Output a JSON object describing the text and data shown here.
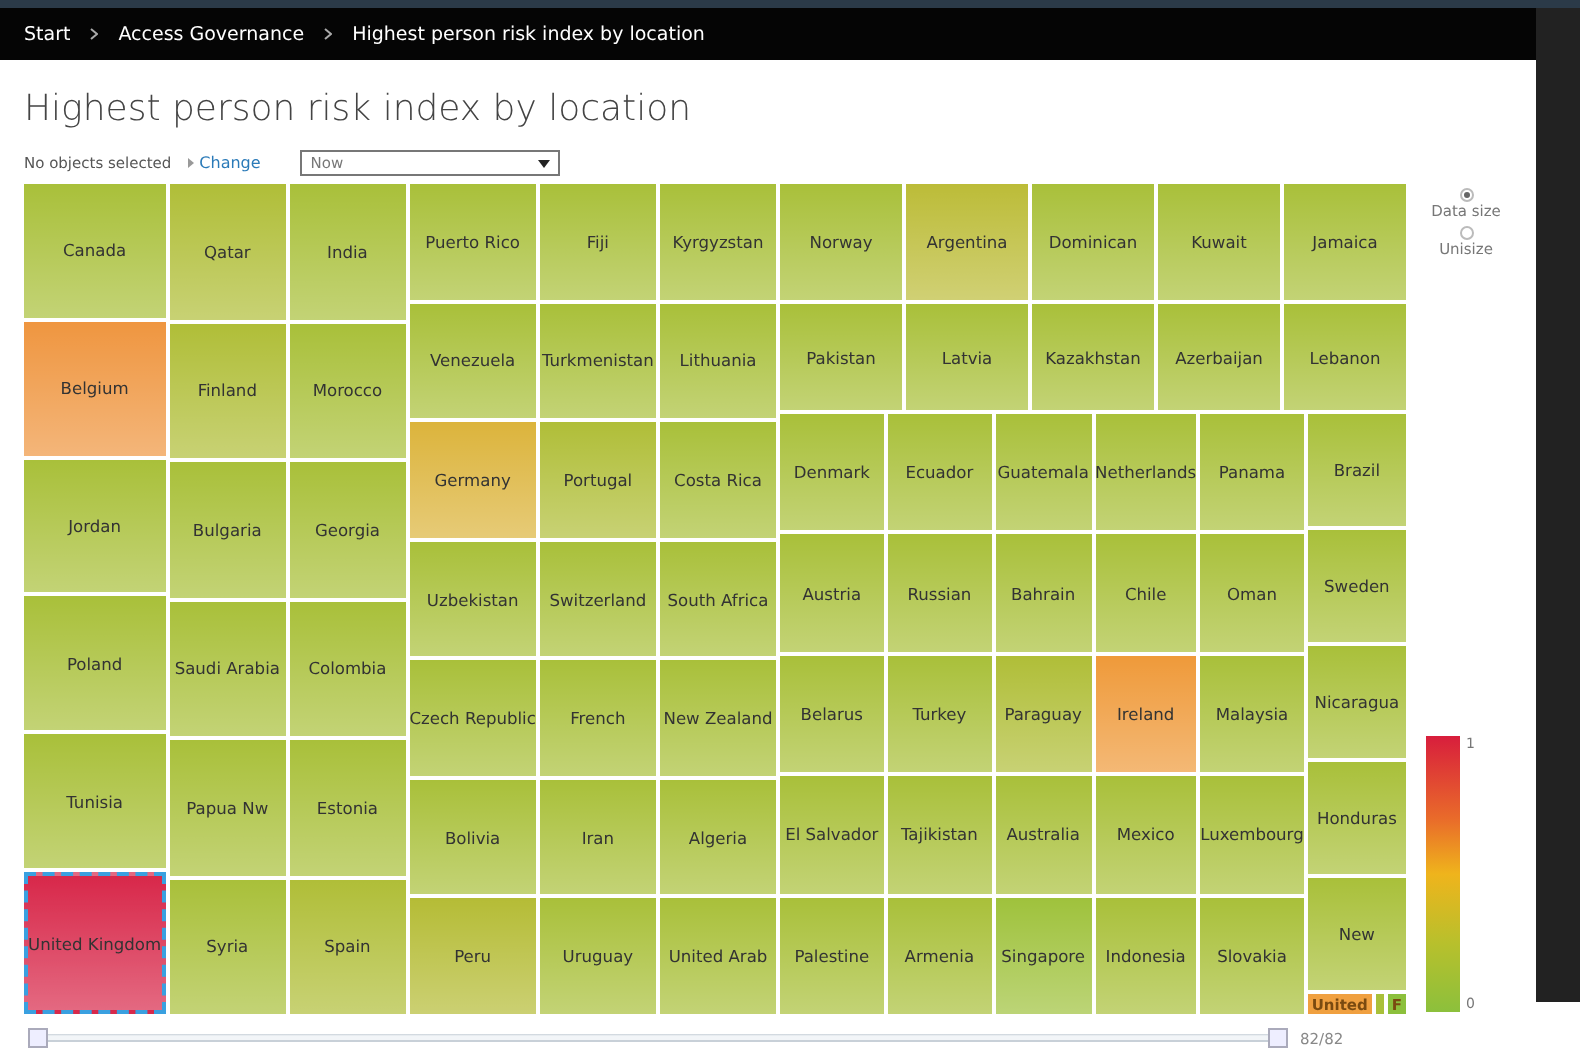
{
  "breadcrumb": [
    {
      "label": "Start"
    },
    {
      "label": "Access Governance"
    },
    {
      "label": "Highest person risk index by location"
    }
  ],
  "title": "Highest person risk index by location",
  "toolbar": {
    "selection": "No objects selected",
    "change_link": "Change",
    "time_dropdown": "Now"
  },
  "treemap": {
    "left_columns": [
      {
        "tiles": [
          {
            "label": "Canada",
            "color": "#a9c03a",
            "selected": false
          },
          {
            "label": "Belgium",
            "color": "#ef9640",
            "selected": false
          },
          {
            "label": "Jordan",
            "color": "#a9c03a",
            "selected": false
          },
          {
            "label": "Poland",
            "color": "#a9c03a",
            "selected": false
          },
          {
            "label": "Tunisia",
            "color": "#a9c03a",
            "selected": false
          },
          {
            "label": "United Kingdom",
            "color": "#d8284a",
            "selected": true
          }
        ]
      },
      {
        "tiles": [
          {
            "label": "Qatar",
            "color": "#b0be38",
            "selected": false
          },
          {
            "label": "Finland",
            "color": "#b0be38",
            "selected": false
          },
          {
            "label": "Bulgaria",
            "color": "#a9c03a",
            "selected": false
          },
          {
            "label": "Saudi Arabia",
            "color": "#a9c03a",
            "selected": false
          },
          {
            "label": "Papua Nw",
            "color": "#a9c03a",
            "selected": false
          },
          {
            "label": "Syria",
            "color": "#a9c03a",
            "selected": false
          }
        ]
      },
      {
        "tiles": [
          {
            "label": "India",
            "color": "#a9c03a",
            "selected": false
          },
          {
            "label": "Morocco",
            "color": "#a9c03a",
            "selected": false
          },
          {
            "label": "Georgia",
            "color": "#a9c03a",
            "selected": false
          },
          {
            "label": "Colombia",
            "color": "#a9c03a",
            "selected": false
          },
          {
            "label": "Estonia",
            "color": "#a9c03a",
            "selected": false
          },
          {
            "label": "Spain",
            "color": "#b0be38",
            "selected": false
          }
        ]
      },
      {
        "tiles": [
          {
            "label": "Puerto Rico",
            "color": "#a9c03a",
            "selected": false
          },
          {
            "label": "Venezuela",
            "color": "#a9c03a",
            "selected": false
          },
          {
            "label": "Germany",
            "color": "#dcb43c",
            "selected": false
          },
          {
            "label": "Uzbekistan",
            "color": "#a9c03a",
            "selected": false
          },
          {
            "label": "Czech Republic",
            "color": "#a9c03a",
            "selected": false
          },
          {
            "label": "Bolivia",
            "color": "#a9c03a",
            "selected": false
          },
          {
            "label": "Peru",
            "color": "#b5bc36",
            "selected": false
          }
        ]
      },
      {
        "tiles": [
          {
            "label": "Fiji",
            "color": "#a9c03a",
            "selected": false
          },
          {
            "label": "Turkmenistan",
            "color": "#a9c03a",
            "selected": false
          },
          {
            "label": "Portugal",
            "color": "#b0be38",
            "selected": false
          },
          {
            "label": "Switzerland",
            "color": "#a9c03a",
            "selected": false
          },
          {
            "label": "French",
            "color": "#a9c03a",
            "selected": false
          },
          {
            "label": "Iran",
            "color": "#a9c03a",
            "selected": false
          },
          {
            "label": "Uruguay",
            "color": "#a9c03a",
            "selected": false
          }
        ]
      },
      {
        "tiles": [
          {
            "label": "Kyrgyzstan",
            "color": "#a9c03a",
            "selected": false
          },
          {
            "label": "Lithuania",
            "color": "#a9c03a",
            "selected": false
          },
          {
            "label": "Costa Rica",
            "color": "#a9c03a",
            "selected": false
          },
          {
            "label": "South Africa",
            "color": "#a9c03a",
            "selected": false
          },
          {
            "label": "New Zealand",
            "color": "#a9c03a",
            "selected": false
          },
          {
            "label": "Algeria",
            "color": "#a9c03a",
            "selected": false
          },
          {
            "label": "United Arab",
            "color": "#a9c03a",
            "selected": false
          }
        ]
      }
    ],
    "right_rows": [
      {
        "tiles": [
          {
            "label": "Norway",
            "color": "#a9c03a",
            "selected": false
          },
          {
            "label": "Argentina",
            "color": "#bcbc38",
            "selected": false
          },
          {
            "label": "Dominican",
            "color": "#a9c03a",
            "selected": false
          },
          {
            "label": "Kuwait",
            "color": "#a9c03a",
            "selected": false
          },
          {
            "label": "Jamaica",
            "color": "#a9c03a",
            "selected": false
          }
        ]
      },
      {
        "tiles": [
          {
            "label": "Pakistan",
            "color": "#a9c03a",
            "selected": false
          },
          {
            "label": "Latvia",
            "color": "#a9c03a",
            "selected": false
          },
          {
            "label": "Kazakhstan",
            "color": "#a9c03a",
            "selected": false
          },
          {
            "label": "Azerbaijan",
            "color": "#a9c03a",
            "selected": false
          },
          {
            "label": "Lebanon",
            "color": "#a9c03a",
            "selected": false
          }
        ]
      }
    ],
    "right_columns": [
      {
        "tiles": [
          {
            "label": "Denmark",
            "color": "#a9c03a",
            "selected": false
          },
          {
            "label": "Austria",
            "color": "#a9c03a",
            "selected": false
          },
          {
            "label": "Belarus",
            "color": "#a9c03a",
            "selected": false
          },
          {
            "label": "El Salvador",
            "color": "#a9c03a",
            "selected": false
          },
          {
            "label": "Palestine",
            "color": "#a9c03a",
            "selected": false
          }
        ]
      },
      {
        "tiles": [
          {
            "label": "Ecuador",
            "color": "#a9c03a",
            "selected": false
          },
          {
            "label": "Russian",
            "color": "#a9c03a",
            "selected": false
          },
          {
            "label": "Turkey",
            "color": "#a9c03a",
            "selected": false
          },
          {
            "label": "Tajikistan",
            "color": "#a9c03a",
            "selected": false
          },
          {
            "label": "Armenia",
            "color": "#a9c03a",
            "selected": false
          }
        ]
      },
      {
        "tiles": [
          {
            "label": "Guatemala",
            "color": "#a9c03a",
            "selected": false
          },
          {
            "label": "Bahrain",
            "color": "#a9c03a",
            "selected": false
          },
          {
            "label": "Paraguay",
            "color": "#b0be38",
            "selected": false
          },
          {
            "label": "Australia",
            "color": "#a9c03a",
            "selected": false
          },
          {
            "label": "Singapore",
            "color": "#9fc23c",
            "selected": false
          }
        ]
      },
      {
        "tiles": [
          {
            "label": "Netherlands",
            "color": "#a9c03a",
            "selected": false
          },
          {
            "label": "Chile",
            "color": "#a9c03a",
            "selected": false
          },
          {
            "label": "Ireland",
            "color": "#ef9a3a",
            "selected": false
          },
          {
            "label": "Mexico",
            "color": "#a9c03a",
            "selected": false
          },
          {
            "label": "Indonesia",
            "color": "#a9c03a",
            "selected": false
          }
        ]
      },
      {
        "tiles": [
          {
            "label": "Panama",
            "color": "#a9c03a",
            "selected": false
          },
          {
            "label": "Oman",
            "color": "#a9c03a",
            "selected": false
          },
          {
            "label": "Malaysia",
            "color": "#a9c03a",
            "selected": false
          },
          {
            "label": "Luxembourg",
            "color": "#a9c03a",
            "selected": false
          },
          {
            "label": "Slovakia",
            "color": "#a9c03a",
            "selected": false
          }
        ]
      },
      {
        "tiles": [
          {
            "label": "Brazil",
            "color": "#a9c03a",
            "selected": false
          },
          {
            "label": "Sweden",
            "color": "#a9c03a",
            "selected": false
          },
          {
            "label": "Nicaragua",
            "color": "#a9c03a",
            "selected": false
          },
          {
            "label": "Honduras",
            "color": "#a9c03a",
            "selected": false
          },
          {
            "label": "New",
            "color": "#a9c03a",
            "selected": false
          }
        ],
        "strip": [
          {
            "label": "United",
            "color": "#f0a040",
            "selected": false
          },
          {
            "color": "#a9c03a",
            "selected": false
          },
          {
            "label": "F",
            "color": "#8cc03c",
            "selected": false
          }
        ]
      }
    ]
  },
  "size_options": [
    {
      "label": "Data size",
      "selected": true
    },
    {
      "label": "Unisize",
      "selected": false
    }
  ],
  "legend": {
    "max_label": "1",
    "min_label": "0"
  },
  "range_slider": {
    "handles": [
      {
        "level": 0
      },
      {
        "level": 1
      }
    ],
    "counter": "82/82"
  }
}
